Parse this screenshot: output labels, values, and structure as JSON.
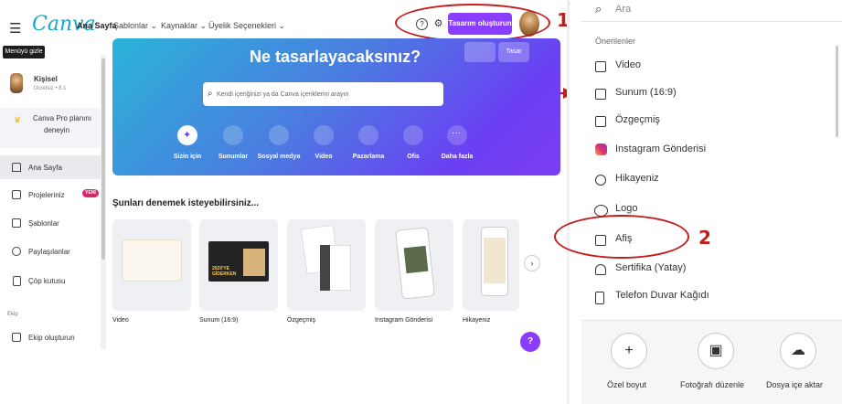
{
  "topbar": {
    "logo": "Canva",
    "nav": [
      "Ana Sayfa",
      "Şablonlar ⌄",
      "Kaynaklar ⌄",
      "Üyelik Seçenekleri ⌄"
    ],
    "create_button": "Tasarım oluşturun",
    "help_glyph": "?",
    "settings_glyph": "⚙"
  },
  "annotations": {
    "one": "1",
    "two": "2"
  },
  "sidebar": {
    "tooltip": "Menüyü gizle",
    "profile_name": "Kişisel",
    "profile_sub": "Ücretsiz • 8.1",
    "pro_line1": "Canva Pro planını",
    "pro_line2": "deneyin",
    "items": [
      {
        "label": "Ana Sayfa",
        "icon": "home-icon"
      },
      {
        "label": "Projeleriniz",
        "icon": "folder-icon"
      },
      {
        "label": "Şablonlar",
        "icon": "templates-icon"
      },
      {
        "label": "Paylaşılanlar",
        "icon": "shared-icon"
      },
      {
        "label": "Çöp kutusu",
        "icon": "trash-icon"
      }
    ],
    "new_badge": "YENİ",
    "team_section": "Ekip",
    "team_create": "Ekip oluşturun"
  },
  "hero": {
    "title": "Ne tasarlayacaksınız?",
    "btn_left": "",
    "btn_right": "Tasar",
    "search_placeholder": "Kendi içeriğinizi ya da Canva içeriklerini arayın",
    "categories": [
      "Sizin için",
      "Sunumlar",
      "Sosyal medya",
      "Video",
      "Pazarlama",
      "Ofis",
      "Daha fazla"
    ]
  },
  "suggestions": {
    "title": "Şunları denemek isteyebilirsiniz...",
    "cards": [
      "Video",
      "Sunum (16:9)",
      "Özgeçmiş",
      "Instagram Gönderisi",
      "Hikayeniz"
    ],
    "card2_text": "2020'YE GİDERKEN"
  },
  "right_panel": {
    "search_placeholder": "Ara",
    "section": "Önerilenler",
    "items": [
      {
        "label": "Video",
        "icon": "video-icon"
      },
      {
        "label": "Sunum (16:9)",
        "icon": "presentation-icon"
      },
      {
        "label": "Özgeçmiş",
        "icon": "resume-icon"
      },
      {
        "label": "Instagram Gönderisi",
        "icon": "instagram-icon"
      },
      {
        "label": "Hikayeniz",
        "icon": "story-icon"
      },
      {
        "label": "Logo",
        "icon": "logo-icon"
      },
      {
        "label": "Afiş",
        "icon": "poster-icon"
      },
      {
        "label": "Sertifika (Yatay)",
        "icon": "certificate-icon"
      },
      {
        "label": "Telefon Duvar Kağıdı",
        "icon": "phone-wallpaper-icon"
      }
    ],
    "bottom": [
      {
        "label": "Özel boyut",
        "glyph": "+"
      },
      {
        "label": "Fotoğrafı düzenle",
        "glyph": "▣"
      },
      {
        "label": "Dosya içe aktar",
        "glyph": "☁"
      }
    ],
    "edge_label": "SI"
  },
  "colors": {
    "accent": "#8b3dff",
    "annotation_red": "#c21d1d",
    "new_badge": "#d8266b",
    "logo": "#1aa5c9"
  }
}
